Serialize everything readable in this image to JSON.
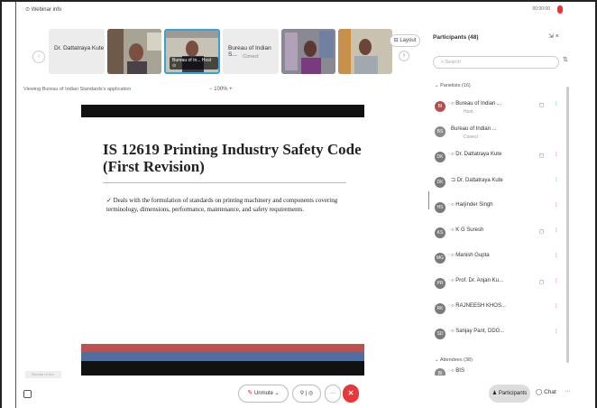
{
  "window": {
    "title": "⊙ Webinar info",
    "time": "00:00:00"
  },
  "strip": {
    "tiles": [
      {
        "type": "name",
        "name": "Dr. Dattatraya Kute"
      },
      {
        "type": "video"
      },
      {
        "type": "video",
        "active": true,
        "label": "Bureau of In...  Host ⊙"
      },
      {
        "type": "name",
        "name": "Bureau of Indian S...",
        "sub": "Conect"
      },
      {
        "type": "video"
      },
      {
        "type": "video"
      }
    ],
    "layout_label": "⊟ Layout"
  },
  "viewing": "Viewing Bureau of Indian Standards's application",
  "zoom": "−  100%  +",
  "slide": {
    "title": "IS 12619 Printing Industry Safety Code (First Revision)",
    "bullet": "✓ Deals with the formulation of standards on printing machinery and components covering terminology, dimensions, performance, maintenance, and safety requirements."
  },
  "controls": {
    "share_label": "Bureau of Ind.",
    "unmute": "Unmute ⌄",
    "participants": "Participants",
    "chat": "◯ Chat",
    "more": "···"
  },
  "panel": {
    "title": "Participants (48)",
    "search_placeholder": "Search",
    "panelists_label": "⌄ Panelists (16)",
    "attendees_label": "⌄ Attendees (38)",
    "panelists": [
      {
        "initials": "BI",
        "name": "○ Bureau of Indian ...",
        "sub": "Host",
        "cam": "◻",
        "mic": "⁞",
        "mic_color": "green",
        "avatar_color": "#b05050"
      },
      {
        "initials": "BS",
        "name": "  Bureau of Indian ...",
        "sub": "Conect",
        "avatar_color": "#8a8a8a"
      },
      {
        "initials": "DK",
        "name": "○ Dr. Dattatraya Kute",
        "cam": "◻",
        "mic": "⁞",
        "avatar_color": "#7a7a7a"
      },
      {
        "initials": "DK",
        "name": "⊐ Dr. Dattatraya Kute",
        "mic": "⁞",
        "mic_color": "green",
        "avatar_color": "#7a7a7a"
      },
      {
        "initials": "HS",
        "name": "○ Harjinder Singh",
        "mic": "⁞",
        "avatar_color": "#7a7a7a"
      },
      {
        "initials": "KS",
        "name": "○ K G Suresh",
        "cam": "◻",
        "mic": "⁞",
        "avatar_color": "#7a7a7a"
      },
      {
        "initials": "MG",
        "name": "○ Manish Gupta",
        "mic": "⁞",
        "avatar_color": "#7a7a7a"
      },
      {
        "initials": "PR",
        "name": "○ Prof. Dr. Anjan Ku...",
        "cam": "◻",
        "mic": "⁞",
        "avatar_color": "#7a7a7a"
      },
      {
        "initials": "RK",
        "name": "○ RAJNEESH KHOS...",
        "mic": "⁞",
        "avatar_color": "#7a7a7a"
      },
      {
        "initials": "SD",
        "name": "○ Sanjay Pant, DDG...",
        "mic": "⁞",
        "avatar_color": "#7a7a7a"
      }
    ],
    "attendee_first": {
      "initials": "BI",
      "name": "○ BIS"
    }
  },
  "colors": {
    "accent": "#3aa0d8",
    "end_call": "#e8383c",
    "slide_red": "#c0504d",
    "slide_blue": "#4f6fa0"
  }
}
